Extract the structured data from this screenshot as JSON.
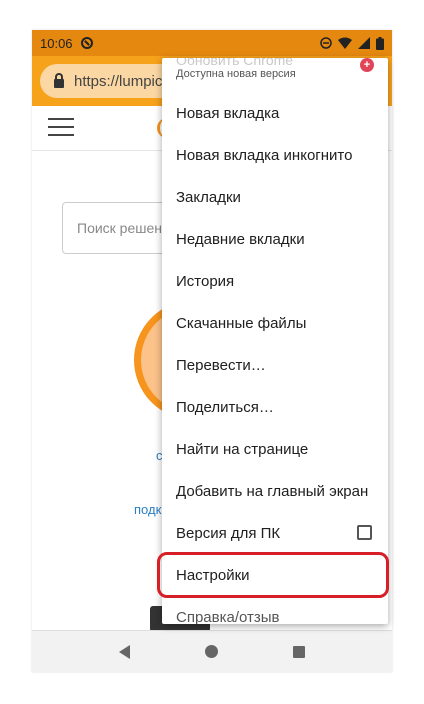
{
  "status_bar": {
    "time": "10:06"
  },
  "browser": {
    "url": "https://lumpics"
  },
  "page": {
    "search_placeholder": "Поиск решен",
    "blue_text_1": "с",
    "blue_text_2": "подк"
  },
  "menu": {
    "update_title": "Обновить Chrome",
    "update_subtitle": "Доступна новая версия",
    "items": [
      {
        "label": "Новая вкладка"
      },
      {
        "label": "Новая вкладка инкогнито"
      },
      {
        "label": "Закладки"
      },
      {
        "label": "Недавние вкладки"
      },
      {
        "label": "История"
      },
      {
        "label": "Скачанные файлы"
      },
      {
        "label": "Перевести…"
      },
      {
        "label": "Поделиться…"
      },
      {
        "label": "Найти на странице"
      },
      {
        "label": "Добавить на главный экран"
      },
      {
        "label": "Версия для ПК"
      },
      {
        "label": "Настройки"
      },
      {
        "label": "Справка/отзыв"
      }
    ]
  },
  "colors": {
    "toolbar": "#f7a21b",
    "status_bar": "#e5880f",
    "highlight": "#d61f26"
  }
}
